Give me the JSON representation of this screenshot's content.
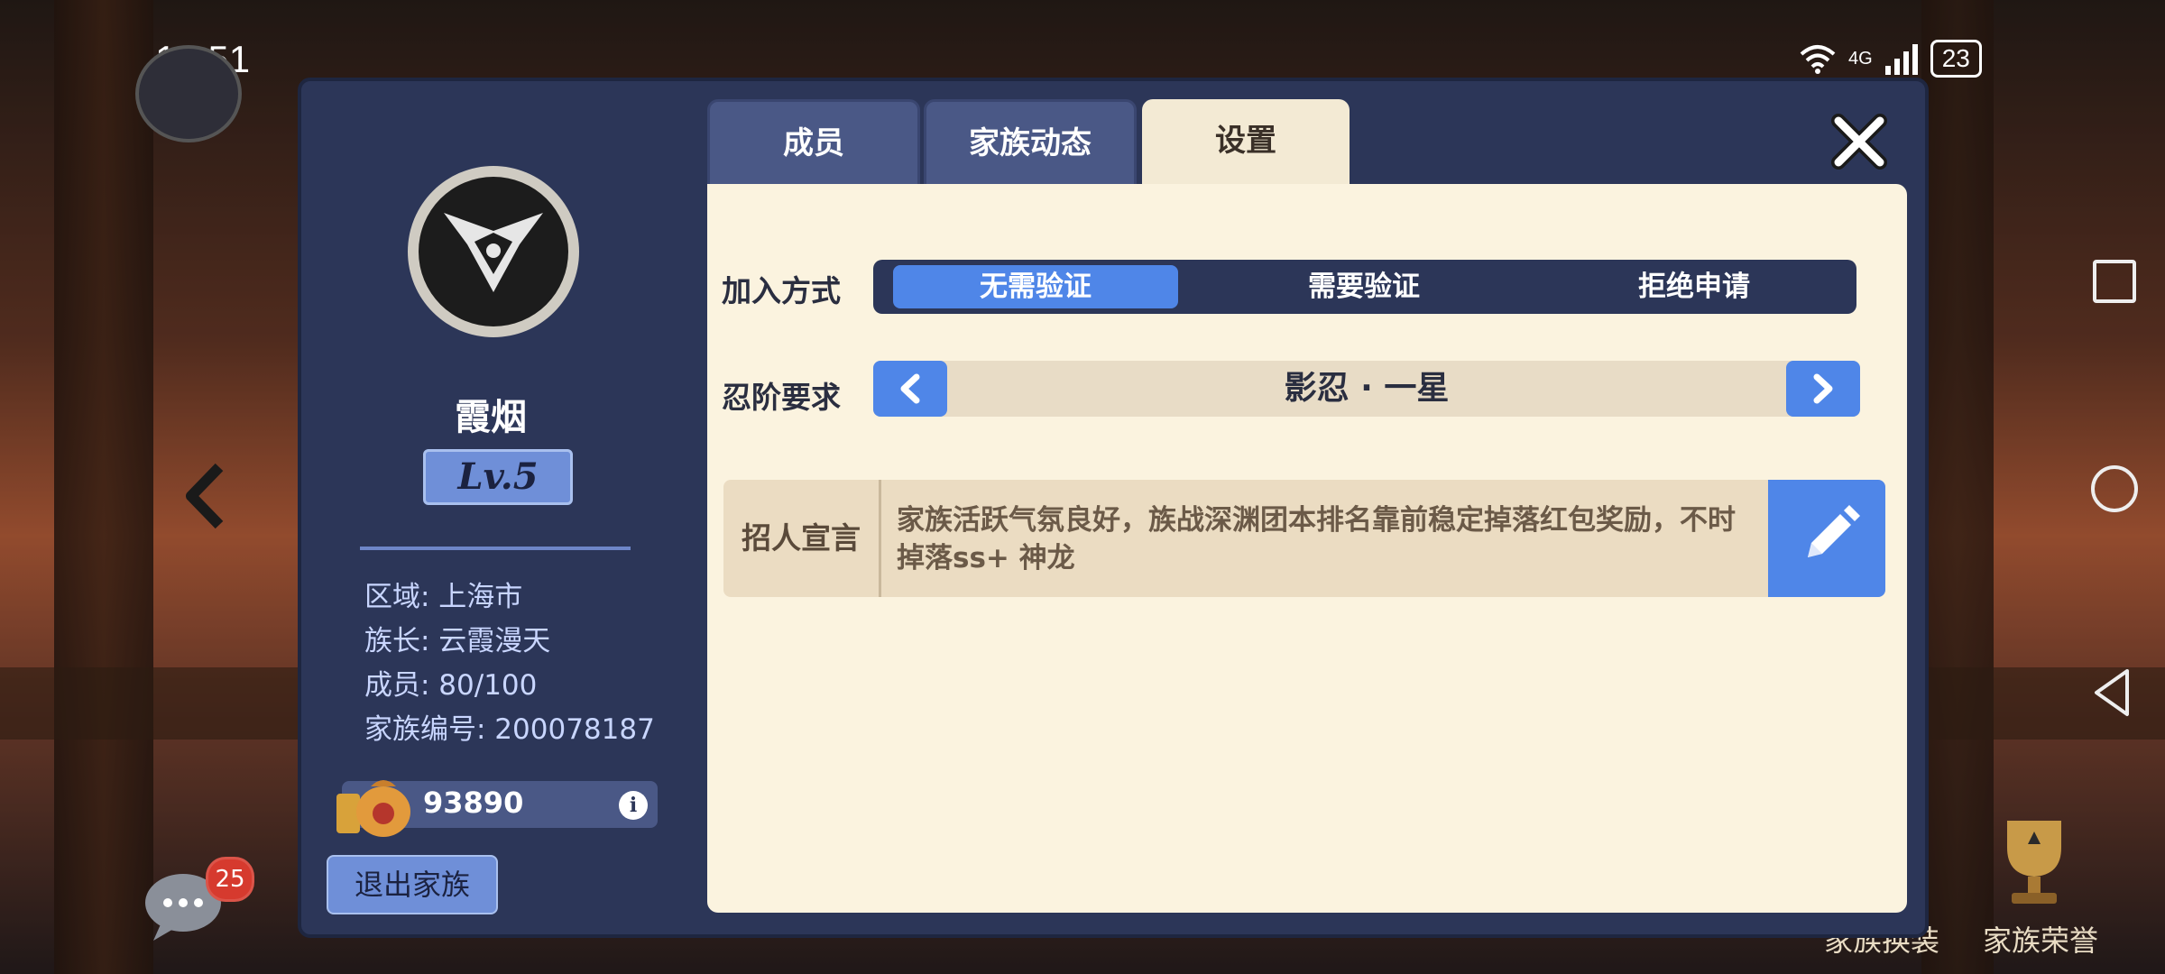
{
  "status_bar": {
    "time": "10:51",
    "network": "4G",
    "battery": "23"
  },
  "dialog": {
    "tabs": [
      {
        "label": "成员",
        "active": false
      },
      {
        "label": "家族动态",
        "active": false
      },
      {
        "label": "设置",
        "active": true
      }
    ],
    "clan": {
      "name": "霞烟",
      "level": "Lv.5",
      "region": "区域: 上海市",
      "leader": "族长: 云霞漫天",
      "members": "成员: 80/100",
      "clan_id": "家族编号: 200078187",
      "funds": "93890",
      "leave_label": "退出家族"
    },
    "settings": {
      "join_label": "加入方式",
      "join_options": [
        "无需验证",
        "需要验证",
        "拒绝申请"
      ],
      "join_selected": "无需验证",
      "rank_label": "忍阶要求",
      "rank_value": "影忍 · 一星",
      "recruit_label": "招人宣言",
      "recruit_text": "家族活跃气氛良好，族战深渊团本排名靠前稳定掉落红包奖励，不时掉落ss+ 神龙"
    }
  },
  "overlay": {
    "chat_badge": "25",
    "family_outfit_label": "家族换装",
    "family_honor_label": "家族荣誉"
  },
  "colors": {
    "accent": "#4f86e8",
    "panel": "#2c3658",
    "content_bg": "#fbf3df",
    "badge": "#d63a2e"
  },
  "icons": [
    "chat-icon",
    "back-arrow-icon",
    "close-icon",
    "chevron-left-icon",
    "chevron-right-icon",
    "pencil-icon",
    "info-icon",
    "coin-bag-icon",
    "clan-emblem-icon",
    "trophy-icon"
  ]
}
